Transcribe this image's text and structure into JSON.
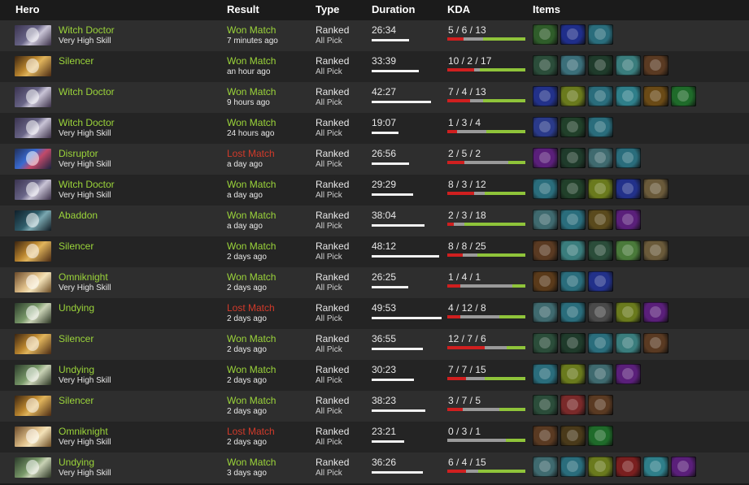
{
  "headers": {
    "hero": "Hero",
    "result": "Result",
    "type": "Type",
    "duration": "Duration",
    "kda": "KDA",
    "items": "Items"
  },
  "colors": {
    "won": "#9bd43a",
    "lost": "#d23a2a",
    "kill_bar": "#d01f1f",
    "assist_bar": "#8fc43a",
    "death_bar": "#9a9a9a"
  },
  "rows": [
    {
      "hero": "Witch Doctor",
      "skill": "Very High Skill",
      "hero_icon": "witch-doctor",
      "result": "Won Match",
      "won": true,
      "when": "7 minutes ago",
      "type": "Ranked",
      "mode": "All Pick",
      "duration": "26:34",
      "kda": "5 / 6 / 13",
      "k": 5,
      "d": 6,
      "a": 13,
      "items": [
        {
          "icon": "staff-item",
          "color": "#2f5d2a"
        },
        {
          "icon": "scepter-item",
          "color": "#1f2e8a"
        },
        {
          "icon": "boots-item",
          "color": "#2a6d7c"
        }
      ]
    },
    {
      "hero": "Silencer",
      "skill": "",
      "hero_icon": "silencer",
      "result": "Won Match",
      "won": true,
      "when": "an hour ago",
      "type": "Ranked",
      "mode": "All Pick",
      "duration": "33:39",
      "kda": "10 / 2 / 17",
      "k": 10,
      "d": 2,
      "a": 17,
      "items": [
        {
          "icon": "staff-item",
          "color": "#2b4d3a"
        },
        {
          "icon": "boots-item",
          "color": "#3b6f7a"
        },
        {
          "icon": "wand-item",
          "color": "#1f3b2b"
        },
        {
          "icon": "shield-item",
          "color": "#3a7d7d"
        },
        {
          "icon": "gloves-item",
          "color": "#5a3a22"
        }
      ]
    },
    {
      "hero": "Witch Doctor",
      "skill": "",
      "hero_icon": "witch-doctor",
      "result": "Won Match",
      "won": true,
      "when": "9 hours ago",
      "type": "Ranked",
      "mode": "All Pick",
      "duration": "42:27",
      "kda": "7 / 4 / 13",
      "k": 7,
      "d": 4,
      "a": 13,
      "items": [
        {
          "icon": "scepter-item",
          "color": "#22318a"
        },
        {
          "icon": "mekansm-item",
          "color": "#6a7a1d"
        },
        {
          "icon": "boots-item",
          "color": "#2a6d7c"
        },
        {
          "icon": "orb-item",
          "color": "#2f7f8a"
        },
        {
          "icon": "lantern-item",
          "color": "#6a4a16"
        },
        {
          "icon": "sphere-item",
          "color": "#1f6b2a"
        }
      ]
    },
    {
      "hero": "Witch Doctor",
      "skill": "Very High Skill",
      "hero_icon": "witch-doctor",
      "result": "Won Match",
      "won": true,
      "when": "24 hours ago",
      "type": "Ranked",
      "mode": "All Pick",
      "duration": "19:07",
      "kda": "1 / 3 / 4",
      "k": 1,
      "d": 3,
      "a": 4,
      "items": [
        {
          "icon": "orb-item",
          "color": "#2a3a8a"
        },
        {
          "icon": "wand-item",
          "color": "#21402a"
        },
        {
          "icon": "boots-item",
          "color": "#2a6d7c"
        }
      ]
    },
    {
      "hero": "Disruptor",
      "skill": "Very High Skill",
      "hero_icon": "disruptor",
      "result": "Lost Match",
      "won": false,
      "when": "a day ago",
      "type": "Ranked",
      "mode": "All Pick",
      "duration": "26:56",
      "kda": "2 / 5 / 2",
      "k": 2,
      "d": 5,
      "a": 2,
      "items": [
        {
          "icon": "ring-item",
          "color": "#5a1f7a"
        },
        {
          "icon": "wand-item",
          "color": "#1f3b2b"
        },
        {
          "icon": "boots-item",
          "color": "#3f6a6f"
        },
        {
          "icon": "boots-item",
          "color": "#2a6d7c"
        }
      ]
    },
    {
      "hero": "Witch Doctor",
      "skill": "Very High Skill",
      "hero_icon": "witch-doctor",
      "result": "Won Match",
      "won": true,
      "when": "a day ago",
      "type": "Ranked",
      "mode": "All Pick",
      "duration": "29:29",
      "kda": "8 / 3 / 12",
      "k": 8,
      "d": 3,
      "a": 12,
      "items": [
        {
          "icon": "boots-item",
          "color": "#2a6d7c"
        },
        {
          "icon": "wand-item",
          "color": "#21402a"
        },
        {
          "icon": "mekansm-item",
          "color": "#6a7a1d"
        },
        {
          "icon": "scepter-item",
          "color": "#22318a"
        },
        {
          "icon": "scroll-item",
          "color": "#6a5a3a"
        }
      ]
    },
    {
      "hero": "Abaddon",
      "skill": "",
      "hero_icon": "abaddon",
      "result": "Won Match",
      "won": true,
      "when": "a day ago",
      "type": "Ranked",
      "mode": "All Pick",
      "duration": "38:04",
      "kda": "2 / 3 / 18",
      "k": 2,
      "d": 3,
      "a": 18,
      "items": [
        {
          "icon": "boots-item",
          "color": "#3f6a6f"
        },
        {
          "icon": "boots-item",
          "color": "#2a6d7c"
        },
        {
          "icon": "mekansm-item",
          "color": "#5a4a1d"
        },
        {
          "icon": "ring-item",
          "color": "#5a1f7a"
        }
      ]
    },
    {
      "hero": "Silencer",
      "skill": "",
      "hero_icon": "silencer",
      "result": "Won Match",
      "won": true,
      "when": "2 days ago",
      "type": "Ranked",
      "mode": "All Pick",
      "duration": "48:12",
      "kda": "8 / 8 / 25",
      "k": 8,
      "d": 8,
      "a": 25,
      "items": [
        {
          "icon": "gloves-item",
          "color": "#5a3a22"
        },
        {
          "icon": "shield-item",
          "color": "#3a7d7d"
        },
        {
          "icon": "staff-item",
          "color": "#2b4d3a"
        },
        {
          "icon": "orb-item",
          "color": "#4a7a3a"
        },
        {
          "icon": "scroll-item",
          "color": "#6a5a3a"
        }
      ]
    },
    {
      "hero": "Omniknight",
      "skill": "Very High Skill",
      "hero_icon": "omniknight",
      "result": "Won Match",
      "won": true,
      "when": "2 days ago",
      "type": "Ranked",
      "mode": "All Pick",
      "duration": "26:25",
      "kda": "1 / 4 / 1",
      "k": 1,
      "d": 4,
      "a": 1,
      "items": [
        {
          "icon": "staff-item",
          "color": "#5a3a1a"
        },
        {
          "icon": "boots-item",
          "color": "#2a6d7c"
        },
        {
          "icon": "scepter-item",
          "color": "#22318a"
        }
      ]
    },
    {
      "hero": "Undying",
      "skill": "",
      "hero_icon": "undying",
      "result": "Lost Match",
      "won": false,
      "when": "2 days ago",
      "type": "Ranked",
      "mode": "All Pick",
      "duration": "49:53",
      "kda": "4 / 12 / 8",
      "k": 4,
      "d": 12,
      "a": 8,
      "items": [
        {
          "icon": "boots-item",
          "color": "#3f6a6f"
        },
        {
          "icon": "boots-item",
          "color": "#2a6d7c"
        },
        {
          "icon": "claw-item",
          "color": "#4a4a4a"
        },
        {
          "icon": "mekansm-item",
          "color": "#6a7a1d"
        },
        {
          "icon": "ring-item",
          "color": "#5a1f7a"
        }
      ]
    },
    {
      "hero": "Silencer",
      "skill": "",
      "hero_icon": "silencer",
      "result": "Won Match",
      "won": true,
      "when": "2 days ago",
      "type": "Ranked",
      "mode": "All Pick",
      "duration": "36:55",
      "kda": "12 / 7 / 6",
      "k": 12,
      "d": 7,
      "a": 6,
      "items": [
        {
          "icon": "staff-item",
          "color": "#2b4d3a"
        },
        {
          "icon": "wand-item",
          "color": "#1f3b2b"
        },
        {
          "icon": "boots-item",
          "color": "#2a6d7c"
        },
        {
          "icon": "shield-item",
          "color": "#3a7d7d"
        },
        {
          "icon": "gloves-item",
          "color": "#5a3a22"
        }
      ]
    },
    {
      "hero": "Undying",
      "skill": "Very High Skill",
      "hero_icon": "undying",
      "result": "Won Match",
      "won": true,
      "when": "2 days ago",
      "type": "Ranked",
      "mode": "All Pick",
      "duration": "30:23",
      "kda": "7 / 7 / 15",
      "k": 7,
      "d": 7,
      "a": 15,
      "items": [
        {
          "icon": "boots-item",
          "color": "#2a6d7c"
        },
        {
          "icon": "mekansm-item",
          "color": "#6a7a1d"
        },
        {
          "icon": "boots-item",
          "color": "#3f6a6f"
        },
        {
          "icon": "ring-item",
          "color": "#5a1f7a"
        }
      ]
    },
    {
      "hero": "Silencer",
      "skill": "",
      "hero_icon": "silencer",
      "result": "Won Match",
      "won": true,
      "when": "2 days ago",
      "type": "Ranked",
      "mode": "All Pick",
      "duration": "38:23",
      "kda": "3 / 7 / 5",
      "k": 3,
      "d": 7,
      "a": 5,
      "items": [
        {
          "icon": "staff-item",
          "color": "#2b4d3a"
        },
        {
          "icon": "orb-item",
          "color": "#7a2a2a"
        },
        {
          "icon": "gloves-item",
          "color": "#5a3a22"
        }
      ]
    },
    {
      "hero": "Omniknight",
      "skill": "Very High Skill",
      "hero_icon": "omniknight",
      "result": "Lost Match",
      "won": false,
      "when": "2 days ago",
      "type": "Ranked",
      "mode": "All Pick",
      "duration": "23:21",
      "kda": "0 / 3 / 1",
      "k": 0,
      "d": 3,
      "a": 1,
      "items": [
        {
          "icon": "gloves-item",
          "color": "#5a3a22"
        },
        {
          "icon": "lantern-item",
          "color": "#4a3a1a"
        },
        {
          "icon": "sphere-item",
          "color": "#1f6b2a"
        }
      ]
    },
    {
      "hero": "Undying",
      "skill": "Very High Skill",
      "hero_icon": "undying",
      "result": "Won Match",
      "won": true,
      "when": "3 days ago",
      "type": "Ranked",
      "mode": "All Pick",
      "duration": "36:26",
      "kda": "6 / 4 / 15",
      "k": 6,
      "d": 4,
      "a": 15,
      "items": [
        {
          "icon": "boots-item",
          "color": "#3f6a6f"
        },
        {
          "icon": "boots-item",
          "color": "#2a6d7c"
        },
        {
          "icon": "mekansm-item",
          "color": "#6a7a1d"
        },
        {
          "icon": "gauntlet-item",
          "color": "#7a1f1f"
        },
        {
          "icon": "orb-item",
          "color": "#2f7f8a"
        },
        {
          "icon": "ring-item",
          "color": "#5a1f7a"
        }
      ]
    }
  ]
}
